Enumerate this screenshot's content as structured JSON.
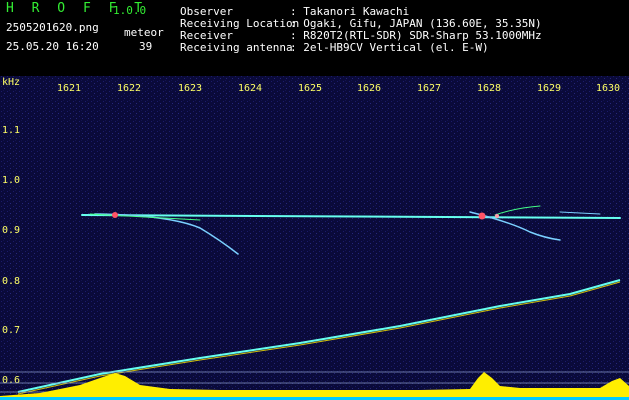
{
  "header": {
    "app_title": "H R O F F T",
    "version": "1.0.0",
    "filename": "2505201620.png",
    "mode": "meteor",
    "datetime": "25.05.20 16:20",
    "count": "39",
    "info": [
      {
        "key": "Observer",
        "value": ": Takanori Kawachi"
      },
      {
        "key": "Receiving Location",
        "value": ": Ogaki, Gifu, JAPAN (136.60E, 35.35N)"
      },
      {
        "key": "Receiver",
        "value": ": R820T2(RTL-SDR) SDR-Sharp 53.1000MHz"
      },
      {
        "key": "Receiving antenna",
        "value": ": 2el-HB9CV Vertical (el. E-W)"
      }
    ]
  },
  "spectrogram": {
    "y_unit": "kHz",
    "x_ticks": [
      "1621",
      "1622",
      "1623",
      "1624",
      "1625",
      "1626",
      "1627",
      "1628",
      "1629",
      "1630"
    ],
    "y_ticks": [
      "1.1",
      "1.0",
      "0.9",
      "0.8",
      "0.7",
      "0.6"
    ],
    "colors": {
      "background": "#0a0a3a",
      "trace": "#66ffee",
      "hotspot": "#ff5566",
      "level": "#ffee00",
      "axis_text": "#ffff66"
    }
  }
}
